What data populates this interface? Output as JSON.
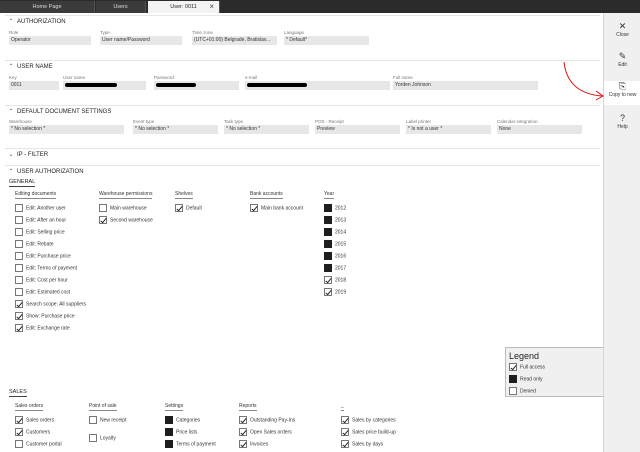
{
  "tabs": [
    {
      "label": "Home Page"
    },
    {
      "label": "Users"
    },
    {
      "label": "User: 0011",
      "close": "×"
    }
  ],
  "commands": [
    {
      "label": "Close",
      "icon": "✕"
    },
    {
      "label": "Edit",
      "icon": "✎"
    },
    {
      "label": "Copy to new",
      "icon": "⎘"
    },
    {
      "label": "Help",
      "icon": "?"
    }
  ],
  "sections": {
    "authorization": "AUTHORIZATION",
    "user_name": "USER NAME",
    "doc_settings": "DEFAULT DOCUMENT SETTINGS",
    "ip_filter": "IP - FILTER",
    "user_authorization": "USER AUTHORIZATION"
  },
  "authorization": {
    "role": {
      "label": "Role",
      "value": "Operator"
    },
    "type": {
      "label": "Type",
      "value": "User name/Password"
    },
    "time_zone": {
      "label": "Time zone",
      "value": "(UTC+01:00) Belgrade, Bratislav..."
    },
    "language": {
      "label": "Language",
      "value": "* Default*"
    }
  },
  "user_name": {
    "key": {
      "label": "Key",
      "value": "0011"
    },
    "user_name": {
      "label": "User name"
    },
    "password": {
      "label": "Password"
    },
    "email": {
      "label": "e-mail"
    },
    "full_name": {
      "label": "Full name",
      "value": "Yorden Johnson"
    }
  },
  "doc_settings": {
    "warehouse": {
      "label": "Warehouse",
      "value": "* No selection *"
    },
    "event_type": {
      "label": "Event type",
      "value": "* No selection *"
    },
    "task_type": {
      "label": "Task type",
      "value": "* No selection *"
    },
    "pos_receipt": {
      "label": "POS - Receipt",
      "value": "Preview"
    },
    "label_printer": {
      "label": "Label printer",
      "value": "* Is not a user *"
    },
    "calendar": {
      "label": "Calendar integration",
      "value": "None"
    }
  },
  "general": {
    "title": "GENERAL",
    "editing_documents": {
      "title": "Editing documents",
      "items": [
        {
          "label": "Edit: Another user",
          "checked": false
        },
        {
          "label": "Edit: After an hour",
          "checked": false
        },
        {
          "label": "Edit: Selling price",
          "checked": false
        },
        {
          "label": "Edit: Rebate",
          "checked": false
        },
        {
          "label": "Edit: Purchase price",
          "checked": false
        },
        {
          "label": "Edit: Terms of payment",
          "checked": false
        },
        {
          "label": "Edit: Cost per hour",
          "checked": false
        },
        {
          "label": "Edit: Estimated cost",
          "checked": false
        },
        {
          "label": "Search scope: All suppliers",
          "checked": true
        },
        {
          "label": "Show: Purchase price",
          "checked": true
        },
        {
          "label": "Edit: Exchange rate",
          "checked": true
        }
      ]
    },
    "warehouse_permissions": {
      "title": "Warehouse permissions",
      "items": [
        {
          "label": "Main warehouse",
          "checked": false
        },
        {
          "label": "Second warehouse",
          "checked": true
        }
      ]
    },
    "shelves": {
      "title": "Shelves",
      "items": [
        {
          "label": "Default",
          "checked": true
        }
      ]
    },
    "bank_accounts": {
      "title": "Bank accounts",
      "items": [
        {
          "label": "Main bank account",
          "checked": true
        }
      ]
    },
    "year": {
      "title": "Year",
      "items": [
        {
          "label": "2012",
          "checked": false
        },
        {
          "label": "2013",
          "checked": false
        },
        {
          "label": "2014",
          "checked": false
        },
        {
          "label": "2015",
          "checked": false
        },
        {
          "label": "2016",
          "checked": false
        },
        {
          "label": "2017",
          "checked": false
        },
        {
          "label": "2018",
          "checked": true
        },
        {
          "label": "2019",
          "checked": true
        }
      ]
    }
  },
  "legend": {
    "title": "Legend",
    "items": [
      {
        "label": "Full access",
        "state": "full"
      },
      {
        "label": "Read only",
        "state": "read"
      },
      {
        "label": "Denied",
        "state": "denied"
      }
    ]
  },
  "sales": {
    "title": "SALES",
    "sales_orders": {
      "title": "Sales orders",
      "items": [
        {
          "label": "Sales orders",
          "checked": true
        },
        {
          "label": "Customers",
          "checked": true
        },
        {
          "label": "Customer portal",
          "checked": false
        }
      ]
    },
    "point_of_sale": {
      "title": "Point of sale",
      "items": [
        {
          "label": "New receipt",
          "checked": false
        },
        {
          "label": "Loyalty",
          "checked": false
        }
      ]
    },
    "settings": {
      "title": "Settings",
      "items": [
        {
          "label": "Categories",
          "checked": false
        },
        {
          "label": "Price lists",
          "checked": false
        },
        {
          "label": "Terms of payment",
          "checked": false
        }
      ]
    },
    "reports": {
      "title": "Reports",
      "items": [
        {
          "label": "Outstanding Pay-Ins",
          "checked": true
        },
        {
          "label": "Open Sales orders",
          "checked": true
        },
        {
          "label": "Invoices",
          "checked": true
        }
      ]
    },
    "extra": {
      "title": "_",
      "items": [
        {
          "label": "Sales by categories",
          "checked": true
        },
        {
          "label": "Sales price build-up",
          "checked": true
        },
        {
          "label": "Sales by days",
          "checked": true
        }
      ]
    }
  }
}
